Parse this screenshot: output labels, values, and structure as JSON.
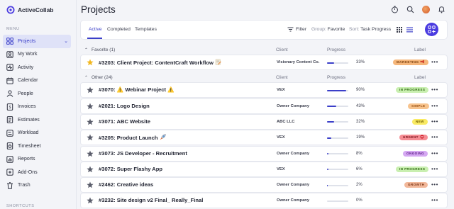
{
  "app": {
    "brand_name": "ActiveCollab"
  },
  "sidebar": {
    "menu_header": "MENU",
    "items": [
      {
        "label": "Projects",
        "icon": "projects-icon",
        "active": true
      },
      {
        "label": "My Work",
        "icon": "my-work-icon"
      },
      {
        "label": "Activity",
        "icon": "activity-icon"
      },
      {
        "label": "Calendar",
        "icon": "calendar-icon"
      },
      {
        "label": "People",
        "icon": "people-icon"
      },
      {
        "label": "Invoices",
        "icon": "invoices-icon"
      },
      {
        "label": "Estimates",
        "icon": "estimates-icon"
      },
      {
        "label": "Workload",
        "icon": "workload-icon"
      },
      {
        "label": "Timesheet",
        "icon": "timesheet-icon"
      },
      {
        "label": "Reports",
        "icon": "reports-icon"
      },
      {
        "label": "Add-Ons",
        "icon": "add-ons-icon"
      },
      {
        "label": "Trash",
        "icon": "trash-icon"
      }
    ],
    "footer_label": "SHORTCUTS"
  },
  "header": {
    "title": "Projects"
  },
  "toolbar": {
    "tabs": [
      {
        "label": "Active",
        "active": true
      },
      {
        "label": "Completed"
      },
      {
        "label": "Templates"
      }
    ],
    "filter_label": "Filter",
    "group_prefix": "Group:",
    "group_value": "Favorite",
    "sort_prefix": "Sort:",
    "sort_value": "Task Progress"
  },
  "columns": {
    "client": "Client",
    "progress": "Progress",
    "label": "Label"
  },
  "colors": {
    "accent": "#3b3fc9",
    "fab": "#4a3be0",
    "star_gold": "#f2b71f",
    "star_gray": "#5b5e6c"
  },
  "groups": [
    {
      "label": "Favorite (1)",
      "rows": [
        {
          "name": "#3203: Client Project: ContentCraft Workflow",
          "emoji": "memo",
          "client": "Visionary Content Co.",
          "progress": 33,
          "pct": "33%",
          "badge": "MARKETING",
          "badge_emoji": "megaphone",
          "badge_bg": "#f5b67a",
          "badge_fg": "#7a3f0d",
          "favorite": true
        }
      ]
    },
    {
      "label": "Other (24)",
      "rows": [
        {
          "name": "#3070: ⚠️ Webinar Project ⚠️",
          "client": "VEX",
          "progress": 90,
          "pct": "90%",
          "badge": "IN PROGRESS",
          "badge_bg": "#c9efb0",
          "badge_fg": "#2e6b12"
        },
        {
          "name": "#2021: Logo Design",
          "client": "Owner Company",
          "progress": 43,
          "pct": "43%",
          "badge": "SIMPLE",
          "badge_bg": "#f7c38d",
          "badge_fg": "#9a5112"
        },
        {
          "name": "#3071: ABC Website",
          "client": "ABC LLC",
          "progress": 32,
          "pct": "32%",
          "badge": "NEW",
          "badge_bg": "#f9ea63",
          "badge_fg": "#6b5a00"
        },
        {
          "name": "#3205: Product Launch",
          "emoji": "rocket",
          "client": "VEX",
          "progress": 19,
          "pct": "19%",
          "badge": "URGENT",
          "badge_emoji": "stop",
          "badge_bg": "#f58d94",
          "badge_fg": "#7a111b"
        },
        {
          "name": "#3073: JS Developer - Recruitment",
          "client": "Owner Company",
          "progress": 8,
          "pct": "8%",
          "badge": "ONGOING",
          "badge_bg": "#d5a8f2",
          "badge_fg": "#5a1a86"
        },
        {
          "name": "#3072: Super Flashy App",
          "client": "VEX",
          "progress": 6,
          "pct": "6%",
          "badge": "IN PROGRESS",
          "badge_bg": "#c9efb0",
          "badge_fg": "#2e6b12"
        },
        {
          "name": "#2462: Creative ideas",
          "client": "Owner Company",
          "progress": 2,
          "pct": "2%",
          "badge": "GROWTH",
          "badge_bg": "#f2b89a",
          "badge_fg": "#7a3313"
        },
        {
          "name": "#3232: Site design v2 Final_ Really_Final",
          "client": "Owner Company",
          "progress": 0,
          "pct": "0%",
          "badge": "",
          "badge_bg": "",
          "badge_fg": ""
        }
      ]
    }
  ]
}
